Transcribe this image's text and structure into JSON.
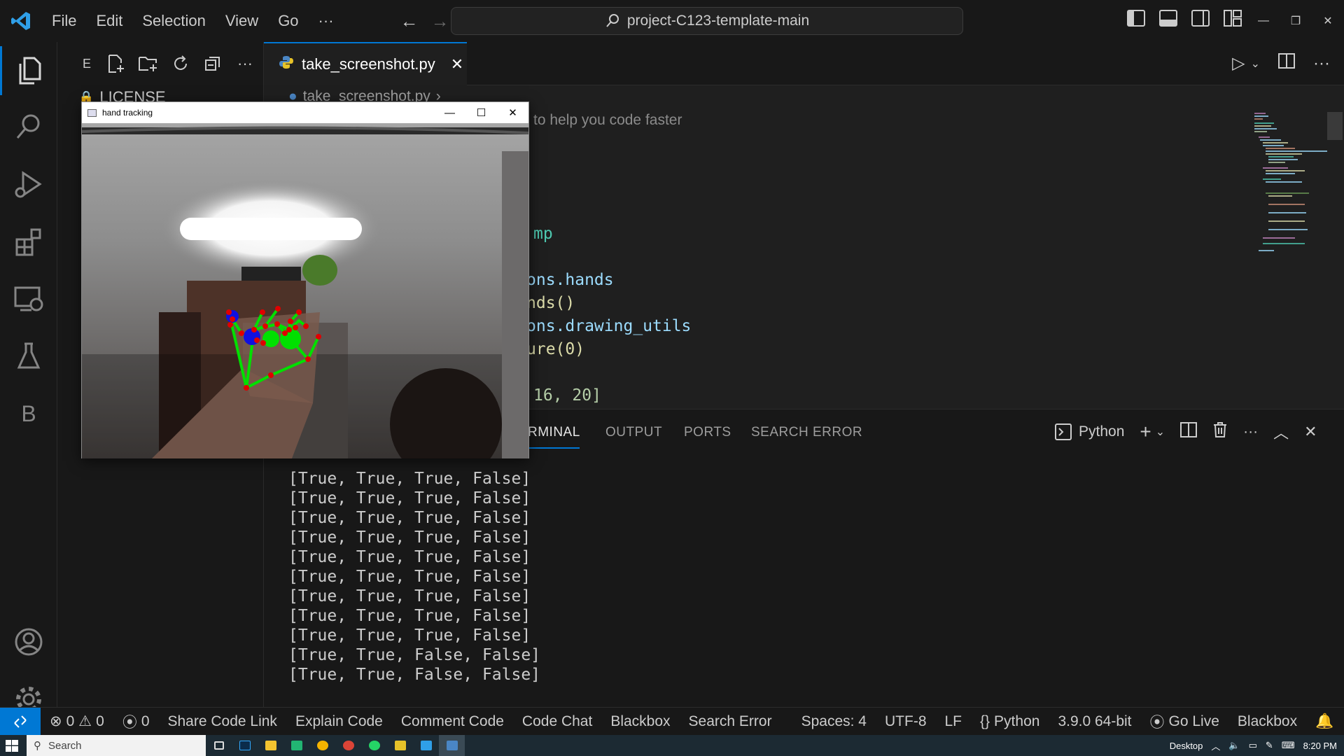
{
  "titlebar": {
    "menu": [
      "File",
      "Edit",
      "Selection",
      "View",
      "Go",
      "···"
    ],
    "search_text": "project-C123-template-main",
    "icons": [
      "vscode-logo-icon",
      "back-arrow-icon",
      "forward-arrow-icon",
      "search-icon",
      "toggle-sidebar-icon",
      "toggle-panel-icon",
      "toggle-secondary-sidebar-icon",
      "customize-layout-icon",
      "minimize-icon",
      "restore-icon",
      "close-icon"
    ]
  },
  "activitybar": {
    "items": [
      "explorer-icon",
      "search-icon",
      "run-debug-icon",
      "extensions-icon",
      "remote-explorer-icon",
      "testing-icon",
      "blackbox-icon"
    ],
    "blackbox_letter": "B",
    "bottom": [
      "accounts-icon",
      "settings-icon"
    ]
  },
  "sidebar": {
    "title_initial": "E",
    "file_label": "LICENSE"
  },
  "editor": {
    "tab_label": "take_screenshot.py",
    "breadcrumb": "take_screenshot.py",
    "hint": "to help you code faster",
    "code_lines": [
      {
        "text": "mp",
        "color": "#4ec9b0"
      },
      {
        "text": "ons.hands",
        "color": "#9cdcfe"
      },
      {
        "text": "nds()",
        "color": "#dcdcaa"
      },
      {
        "text": "ons.drawing_utils",
        "color": "#9cdcfe"
      },
      {
        "text": "ure(0)",
        "color": "#dcdcaa"
      },
      {
        "text": " 16, 20]",
        "color": "#b5cea8"
      }
    ]
  },
  "panel": {
    "tabs": [
      "RMINAL",
      "OUTPUT",
      "PORTS",
      "SEARCH ERROR"
    ],
    "active_tab": "RMINAL",
    "shell_label": "Python",
    "terminal_lines": [
      "[True, True, True, False]",
      "[True, True, True, False]",
      "[True, True, True, False]",
      "[True, True, True, False]",
      "[True, True, True, False]",
      "[True, True, True, False]",
      "[True, True, True, False]",
      "[True, True, True, False]",
      "[True, True, True, False]",
      "[True, True, False, False]",
      "[True, True, False, False]"
    ]
  },
  "statusbar": {
    "errors": "0",
    "warnings": "0",
    "ports": "0",
    "items": [
      "Share Code Link",
      "Explain Code",
      "Comment Code",
      "Code Chat",
      "Blackbox",
      "Search Error"
    ],
    "right_items": [
      "Spaces: 4",
      "UTF-8",
      "LF"
    ],
    "language": "Python",
    "interpreter": "3.9.0 64-bit",
    "golive": "Go Live",
    "blackbox": "Blackbox"
  },
  "taskbar": {
    "search_placeholder": "Search",
    "desktop_label": "Desktop",
    "time": "8:20 PM"
  },
  "cv_window": {
    "title": "hand tracking"
  },
  "colors": {
    "accent": "#0078d4",
    "landmark_line": "#00e000",
    "landmark_point": "#e00000",
    "tip_marker": "#1010e0"
  }
}
